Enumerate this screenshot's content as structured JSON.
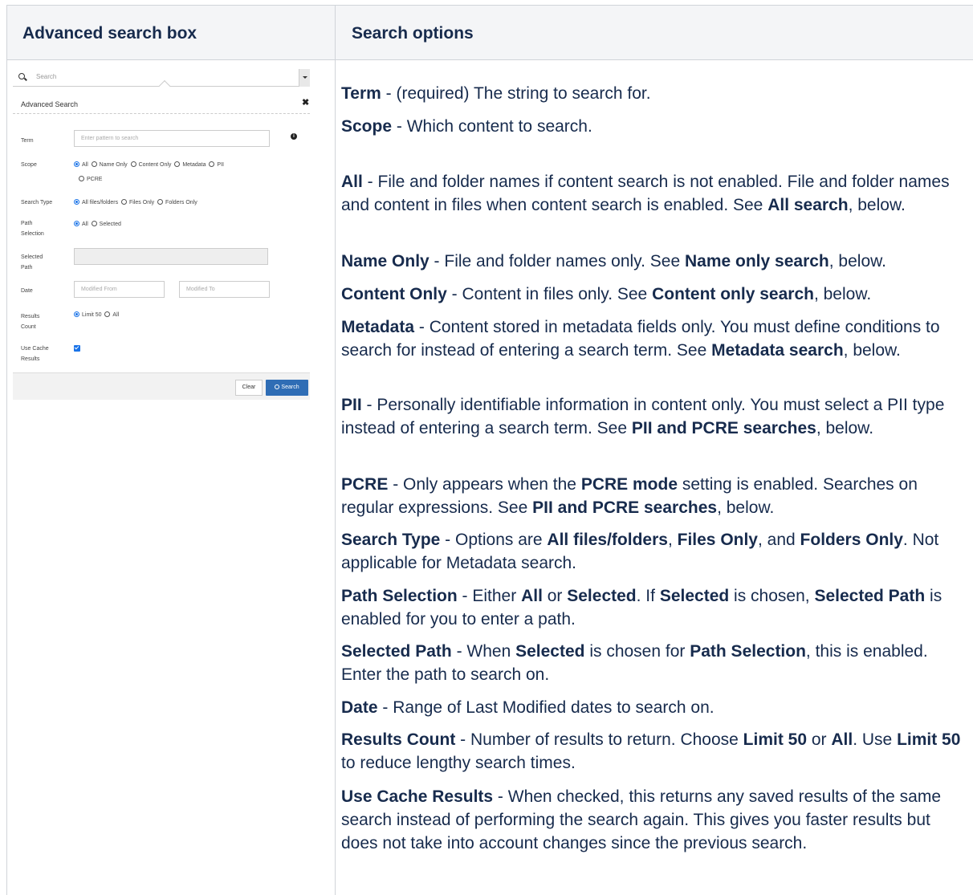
{
  "table": {
    "headers": [
      "Advanced search box",
      "Search options"
    ]
  },
  "mini_ui": {
    "search_placeholder": "Search",
    "panel_title": "Advanced Search",
    "close_glyph": "✖",
    "labels": {
      "term": "Term",
      "scope": "Scope",
      "search_type": "Search Type",
      "path_selection_1": "Path",
      "path_selection_2": "Selection",
      "selected_path_1": "Selected",
      "selected_path_2": "Path",
      "date": "Date",
      "results_count_1": "Results",
      "results_count_2": "Count",
      "use_cache_1": "Use Cache",
      "use_cache_2": "Results"
    },
    "term_placeholder": "Enter pattern to search",
    "info_glyph": "i",
    "scope_options": [
      "All",
      "Name Only",
      "Content Only",
      "Metadata",
      "PII",
      "PCRE"
    ],
    "search_type_options": [
      "All files/folders",
      "Files Only",
      "Folders Only"
    ],
    "path_options": [
      "All",
      "Selected"
    ],
    "date_from": "Modified From",
    "date_to": "Modified To",
    "results_options": [
      "Limit 50",
      "All"
    ],
    "clear_button": "Clear",
    "search_button": "Search"
  },
  "descriptions": [
    {
      "segments": [
        [
          "b",
          "Term"
        ],
        [
          "t",
          " - (required) The string to search for."
        ]
      ]
    },
    {
      "segments": [
        [
          "b",
          "Scope"
        ],
        [
          "t",
          " - Which content to search."
        ]
      ]
    },
    {
      "segments": [
        [
          "b",
          "All"
        ],
        [
          "t",
          " - File and folder names if content search is not enabled. File and folder names and content in files when content search is enabled. See "
        ],
        [
          "b",
          "All search"
        ],
        [
          "t",
          ", below."
        ]
      ]
    },
    {
      "segments": [
        [
          "b",
          "Name Only"
        ],
        [
          "t",
          " - File and folder names only. See "
        ],
        [
          "b",
          "Name only search"
        ],
        [
          "t",
          ", below."
        ]
      ]
    },
    {
      "segments": [
        [
          "b",
          "Content Only"
        ],
        [
          "t",
          " - Content in files only. See "
        ],
        [
          "b",
          "Content only search"
        ],
        [
          "t",
          ", below."
        ]
      ]
    },
    {
      "segments": [
        [
          "b",
          "Metadata"
        ],
        [
          "t",
          " - Content stored in metadata fields only. You must define conditions to search for instead of entering a search term. See "
        ],
        [
          "b",
          "Metadata search"
        ],
        [
          "t",
          ", below."
        ]
      ]
    },
    {
      "segments": [
        [
          "b",
          "PII"
        ],
        [
          "t",
          " - Personally identifiable information in content only. You must select a PII type instead of entering a search term. See "
        ],
        [
          "b",
          "PII and PCRE searches"
        ],
        [
          "t",
          ", below."
        ]
      ]
    },
    {
      "segments": [
        [
          "b",
          "PCRE"
        ],
        [
          "t",
          " - Only appears when the "
        ],
        [
          "b",
          "PCRE mode"
        ],
        [
          "t",
          " setting is enabled. Searches on regular expressions. See "
        ],
        [
          "b",
          "PII and PCRE searches"
        ],
        [
          "t",
          ", below."
        ]
      ]
    },
    {
      "segments": [
        [
          "b",
          "Search Type"
        ],
        [
          "t",
          " - Options are "
        ],
        [
          "b",
          "All files/folders"
        ],
        [
          "t",
          ", "
        ],
        [
          "b",
          "Files Only"
        ],
        [
          "t",
          ", and "
        ],
        [
          "b",
          "Folders Only"
        ],
        [
          "t",
          ". Not applicable for Metadata search."
        ]
      ]
    },
    {
      "segments": [
        [
          "b",
          "Path Selection"
        ],
        [
          "t",
          " - Either "
        ],
        [
          "b",
          "All"
        ],
        [
          "t",
          " or "
        ],
        [
          "b",
          "Selected"
        ],
        [
          "t",
          ". If "
        ],
        [
          "b",
          "Selected"
        ],
        [
          "t",
          " is chosen, "
        ],
        [
          "b",
          "Selected Path"
        ],
        [
          "t",
          " is enabled for you to enter a path."
        ]
      ]
    },
    {
      "segments": [
        [
          "b",
          "Selected Path"
        ],
        [
          "t",
          " - When "
        ],
        [
          "b",
          "Selected"
        ],
        [
          "t",
          " is chosen for "
        ],
        [
          "b",
          "Path Selection"
        ],
        [
          "t",
          ", this is enabled. Enter the path to search on."
        ]
      ]
    },
    {
      "segments": [
        [
          "b",
          "Date"
        ],
        [
          "t",
          " - Range of Last Modified dates to search on."
        ]
      ]
    },
    {
      "segments": [
        [
          "b",
          "Results Count"
        ],
        [
          "t",
          " - Number of results to return. Choose "
        ],
        [
          "b",
          "Limit 50"
        ],
        [
          "t",
          " or "
        ],
        [
          "b",
          "All"
        ],
        [
          "t",
          ". Use "
        ],
        [
          "b",
          "Limit 50"
        ],
        [
          "t",
          " to reduce lengthy search times."
        ]
      ]
    },
    {
      "segments": [
        [
          "b",
          "Use Cache Results"
        ],
        [
          "t",
          " - When checked, this returns any saved results of the same search instead of performing the search again. This gives you faster results but does not take into account changes since the previous search."
        ]
      ]
    }
  ]
}
